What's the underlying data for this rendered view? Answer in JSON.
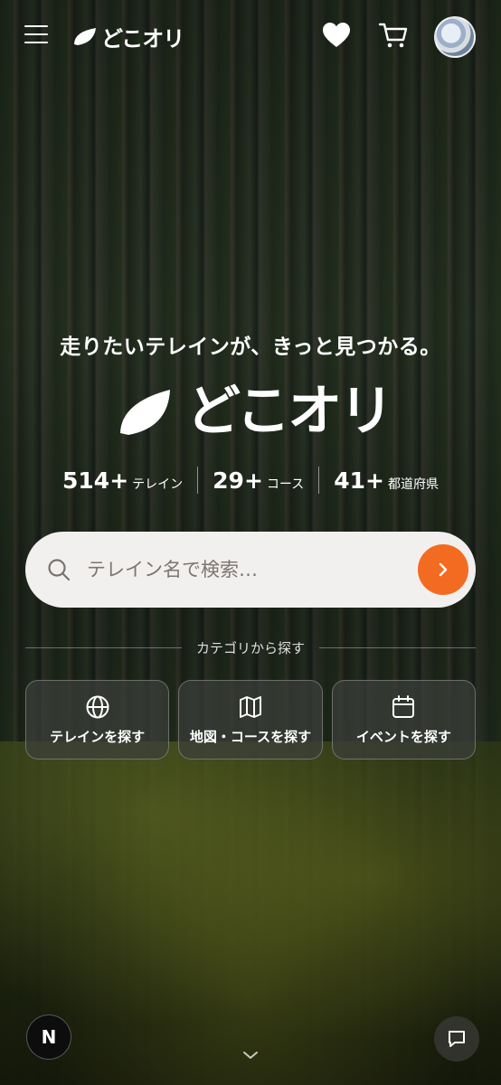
{
  "header": {
    "brand": "どこオリ"
  },
  "hero": {
    "tagline": "走りたいテレインが、きっと見つかる。",
    "brand": "どこオリ",
    "stats": [
      {
        "num": "514+",
        "label": "テレイン"
      },
      {
        "num": "29+",
        "label": "コース"
      },
      {
        "num": "41+",
        "label": "都道府県"
      }
    ]
  },
  "search": {
    "placeholder": "テレイン名で検索…"
  },
  "category": {
    "title": "カテゴリから探す",
    "buttons": [
      {
        "label": "テレインを探す",
        "icon": "globe-icon"
      },
      {
        "label": "地図・コースを探す",
        "icon": "map-icon"
      },
      {
        "label": "イベントを探す",
        "icon": "calendar-icon"
      }
    ]
  },
  "footer": {
    "badge": "N"
  },
  "colors": {
    "accent": "#f36b21",
    "search_bg": "#f2f0ee"
  }
}
